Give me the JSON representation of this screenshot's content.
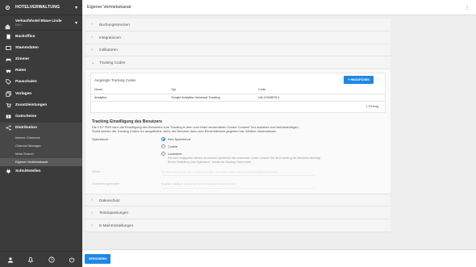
{
  "sidebar": {
    "header_title": "HOTELVERWALTUNG",
    "hotel_name": "Verkaufshotel Blaue Linde",
    "hotel_code": "DEO",
    "items": [
      {
        "label": "Backoffice",
        "icon": "building-icon"
      },
      {
        "label": "Stammdaten",
        "icon": "database-icon"
      },
      {
        "label": "Zimmer",
        "icon": "bed-icon"
      },
      {
        "label": "Raten",
        "icon": "car-icon"
      },
      {
        "label": "Pauschalen",
        "icon": "tag-icon"
      },
      {
        "label": "Vorlagen",
        "icon": "copy-icon"
      },
      {
        "label": "Zusatzleistungen",
        "icon": "cart-icon"
      },
      {
        "label": "Gutscheine",
        "icon": "voucher-icon"
      },
      {
        "label": "Distribution",
        "icon": "share-icon"
      }
    ],
    "subitems": [
      "Interne Channels",
      "Channel Manager",
      "Meta Search",
      "Eigener Vertriebskanal"
    ],
    "last_item": {
      "label": "Schnittstellen",
      "icon": "plug-icon"
    }
  },
  "topbar": {
    "title": "Eigener Vertriebskanal",
    "menu_icon": "more-vert-icon"
  },
  "accordion_top": [
    "Buchungsstrecken",
    "Integrationen",
    "Indikatoren"
  ],
  "tracking": {
    "section_label": "Tracking Codes",
    "card_title": "Angelegte Tracking Codes",
    "add_button": "+ HINZUFÜGEN",
    "columns": [
      "Name",
      "Typ",
      "Code"
    ],
    "rows": [
      [
        "Analytics",
        "Google Analytics Universal Tracking",
        "UA-12345678-1"
      ]
    ],
    "footer": "1 Eintrag"
  },
  "consent": {
    "title": "Tracking Einwilligung des Benutzers",
    "desc1": "Die CST PMS kann die Einwilligung des Benutzers zum Tracking in dem vom Hotel verwendeten Cookie Consent Tool auslesen und berücksichtigen.",
    "desc2": "Somit werden die Tracking Codes nur ausgeliefert, wenn der Benutzer dazu sein Einverständnis gegeben hat. Weitere Informationen",
    "storage_label": "Speicherort",
    "options": [
      "Kein Speicherort",
      "Cookie",
      "Localstore"
    ],
    "help": "Hier kann eingegeben werden, an welchem Speicherort das verwendete Cookie Consent Tool die Einstellung des Benutzers hinterlegt. Bei der Einstellung „Kein Speicherort“, werden die Tracking Codes immer ...",
    "name_label": "Name",
    "name_help": "Der Name des Cookies bzw. Localstore-Eintrags in dem das Cookie Consent Tool die Einwilligung speichert.",
    "regex_label": "Zustimmungsmuster",
    "regex_link": "Regulärer Ausdruck",
    "regex_help": ", auf das dem Wert im Speicherort überprüft wird."
  },
  "accordion_bottom": [
    "Datenschutz",
    "Textanpassungen",
    "E-Mail-Einstellungen"
  ],
  "save_button": "SPEICHERN",
  "colors": {
    "sidebar_bg": "#3b3b3b",
    "accent": "#1e88e5"
  }
}
